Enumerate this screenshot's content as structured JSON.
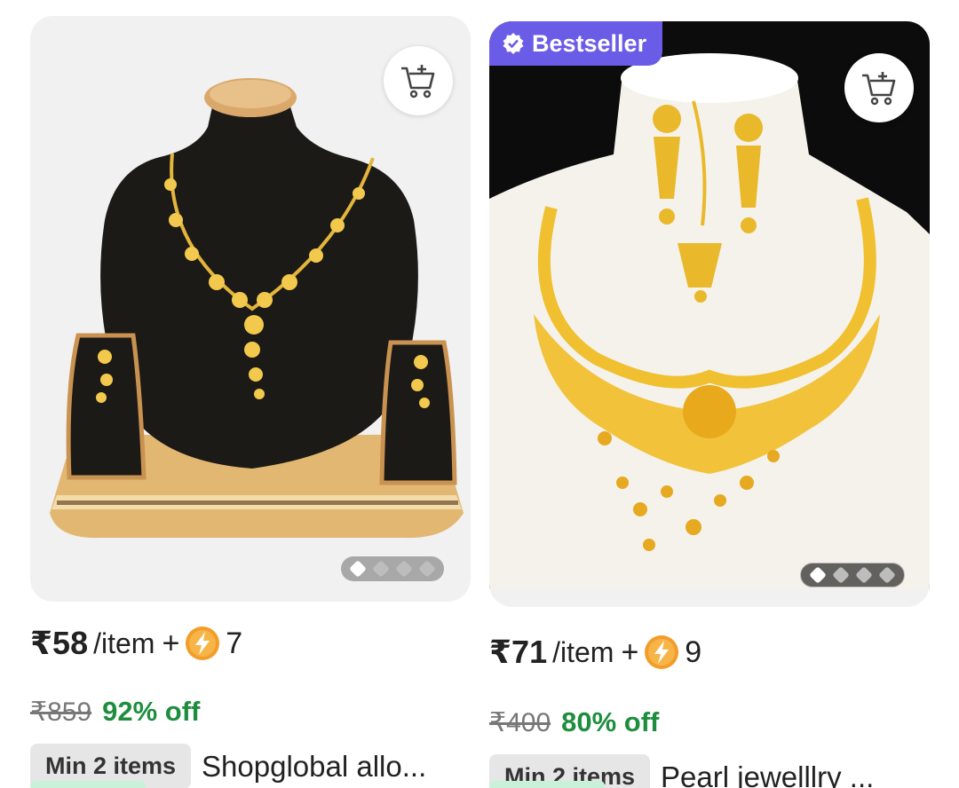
{
  "products": [
    {
      "price": "₹58",
      "per_unit": "/item",
      "plus": "+",
      "coin_icon": "lightning-coin-icon",
      "coins": "7",
      "mrp": "₹859",
      "discount": "92% off",
      "min_items": "Min 2 items",
      "title": "Shopglobal allo..."
    },
    {
      "badge": "Bestseller",
      "price": "₹71",
      "per_unit": "/item",
      "plus": "+",
      "coin_icon": "lightning-coin-icon",
      "coins": "9",
      "mrp": "₹400",
      "discount": "80% off",
      "min_items": "Min 2 items",
      "title": "Pearl jewelllry ..."
    }
  ],
  "colors": {
    "accent_badge": "#6b5ce7",
    "discount_green": "#1e8e3e",
    "coin_orange": "#f39c2a"
  }
}
